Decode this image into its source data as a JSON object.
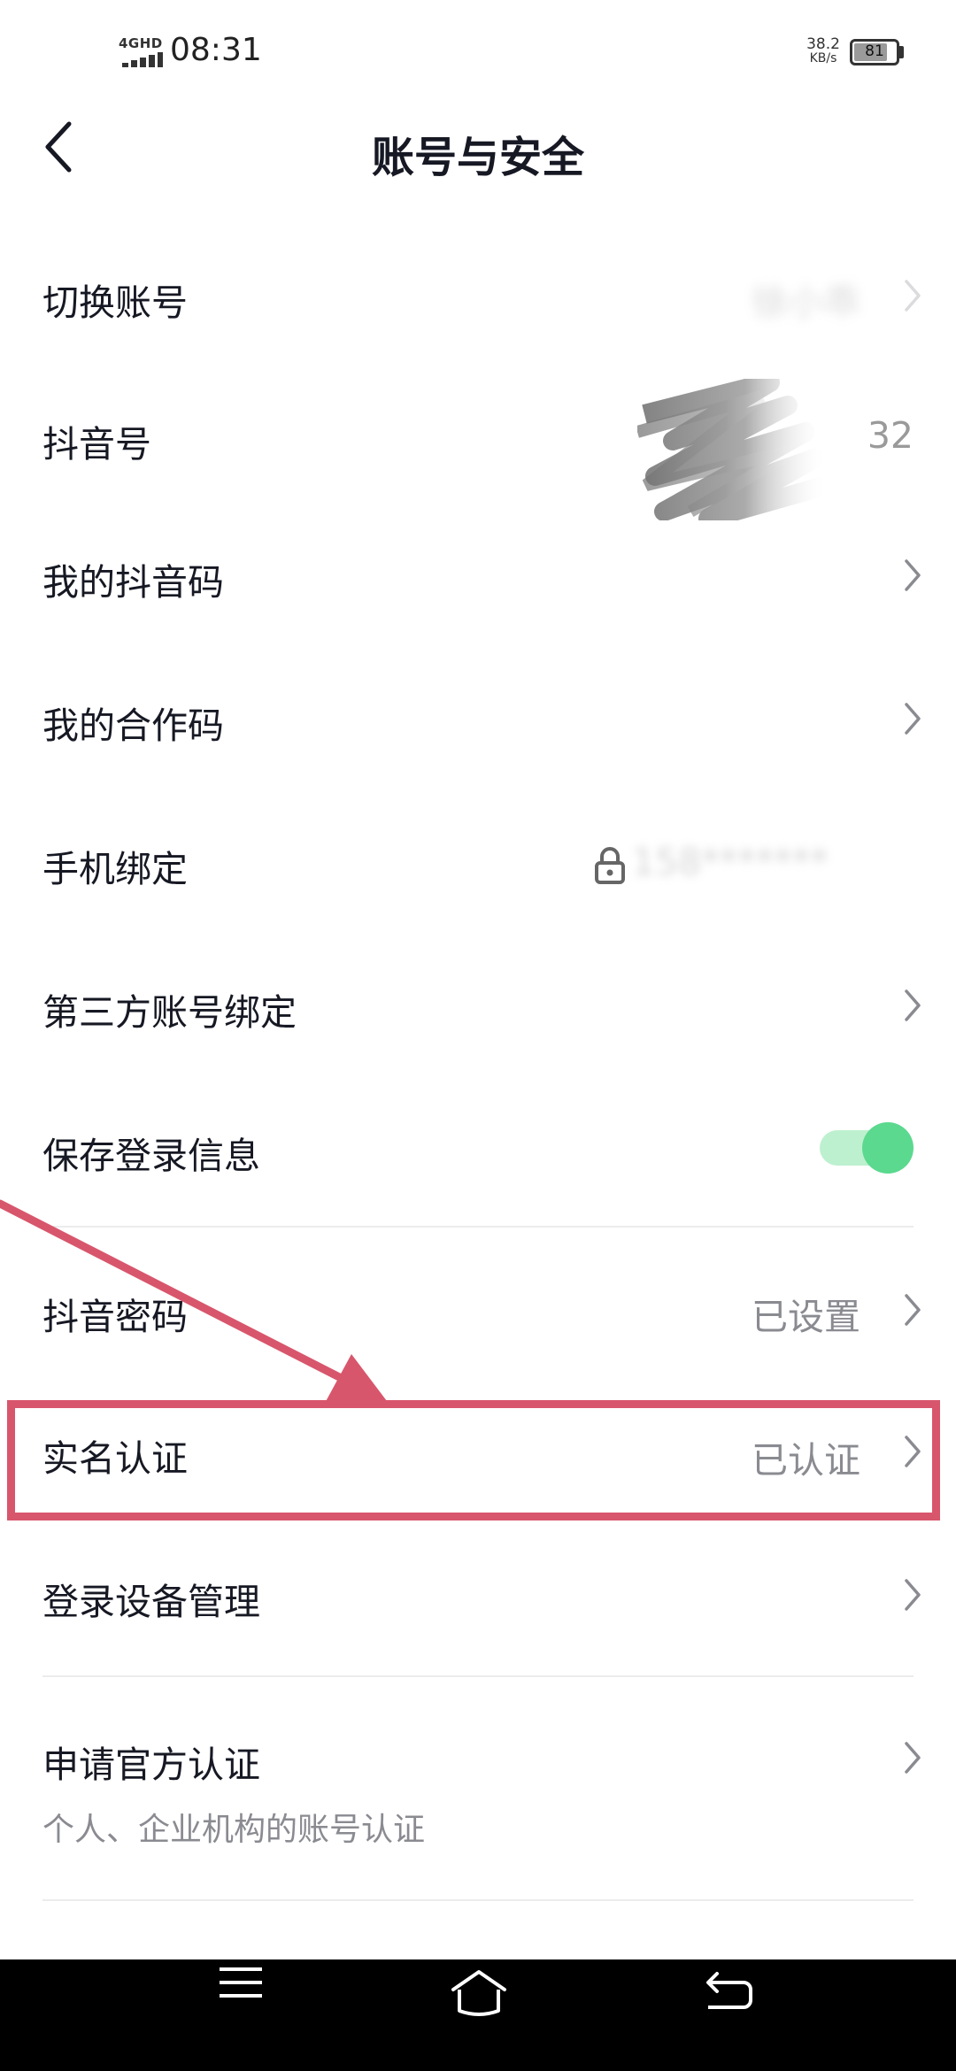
{
  "status_bar": {
    "network": "4GHD",
    "time": "08:31",
    "speed_value": "38.2",
    "speed_unit": "KB/s",
    "battery": "81",
    "battery_level": 0.81
  },
  "header": {
    "title": "账号与安全"
  },
  "rows": {
    "switch_account": {
      "label": "切换账号",
      "value": "徐小乖"
    },
    "douyin_id": {
      "label": "抖音号",
      "value_suffix": "32"
    },
    "my_qr": {
      "label": "我的抖音码"
    },
    "collab_code": {
      "label": "我的合作码"
    },
    "phone_binding": {
      "label": "手机绑定",
      "value": "158*******"
    },
    "third_party": {
      "label": "第三方账号绑定"
    },
    "save_login": {
      "label": "保存登录信息",
      "enabled": true
    },
    "password": {
      "label": "抖音密码",
      "value": "已设置"
    },
    "real_name": {
      "label": "实名认证",
      "value": "已认证"
    },
    "device_mgmt": {
      "label": "登录设备管理"
    },
    "official_verify": {
      "label": "申请官方认证",
      "sub": "个人、企业机构的账号认证"
    }
  },
  "colors": {
    "accent": "#5bd98f",
    "annotation": "#d8566c",
    "text_primary": "#161823",
    "text_secondary": "#8a8b91"
  },
  "icons": [
    "back-arrow-icon",
    "chevron-right-icon",
    "lock-icon",
    "toggle-switch",
    "menu-icon",
    "home-icon",
    "return-icon"
  ]
}
